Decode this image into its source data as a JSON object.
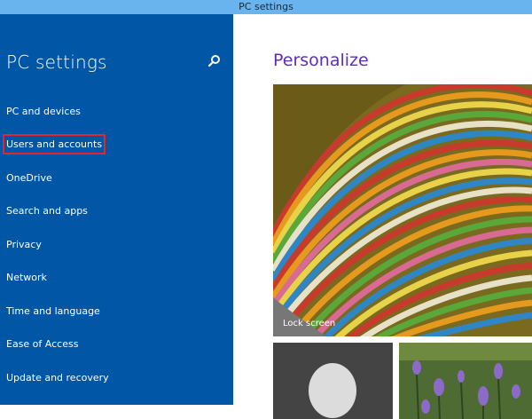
{
  "window": {
    "title": "PC settings"
  },
  "sidebar": {
    "title": "PC settings",
    "search_icon": "search-icon",
    "items": [
      {
        "label": "PC and devices"
      },
      {
        "label": "Users and accounts",
        "highlighted": true
      },
      {
        "label": "OneDrive"
      },
      {
        "label": "Search and apps"
      },
      {
        "label": "Privacy"
      },
      {
        "label": "Network"
      },
      {
        "label": "Time and language"
      },
      {
        "label": "Ease of Access"
      },
      {
        "label": "Update and recovery"
      }
    ]
  },
  "main": {
    "title": "Personalize",
    "lock_screen_label": "Lock screen"
  },
  "colors": {
    "sidebar_bg": "#0156a6",
    "titlebar_bg": "#69b3ee",
    "accent_purple": "#5b2eb7",
    "highlight_border": "#e0282a"
  }
}
